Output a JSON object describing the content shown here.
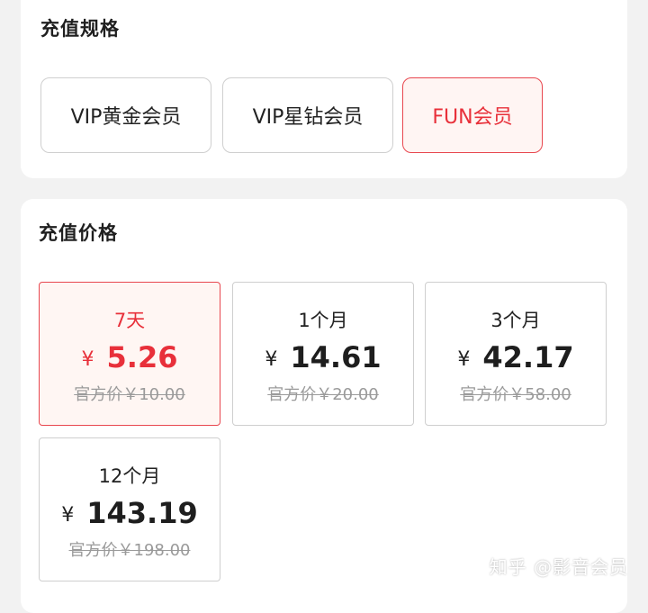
{
  "spec_section": {
    "title": "充值规格",
    "options": [
      {
        "label": "VIP黄金会员",
        "selected": false
      },
      {
        "label": "VIP星钻会员",
        "selected": false
      },
      {
        "label": "FUN会员",
        "selected": true
      }
    ]
  },
  "price_section": {
    "title": "充值价格",
    "options": [
      {
        "duration": "7天",
        "currency": "¥",
        "price": "5.26",
        "original": "官方价￥10.00",
        "selected": true
      },
      {
        "duration": "1个月",
        "currency": "¥",
        "price": "14.61",
        "original": "官方价￥20.00",
        "selected": false
      },
      {
        "duration": "3个月",
        "currency": "¥",
        "price": "42.17",
        "original": "官方价￥58.00",
        "selected": false
      },
      {
        "duration": "12个月",
        "currency": "¥",
        "price": "143.19",
        "original": "官方价￥198.00",
        "selected": false
      }
    ]
  },
  "watermark": "知乎 @影音会员",
  "colors": {
    "accent": "#e8303a",
    "selected_bg": "#fff5f3",
    "border": "#cfcfcf"
  }
}
